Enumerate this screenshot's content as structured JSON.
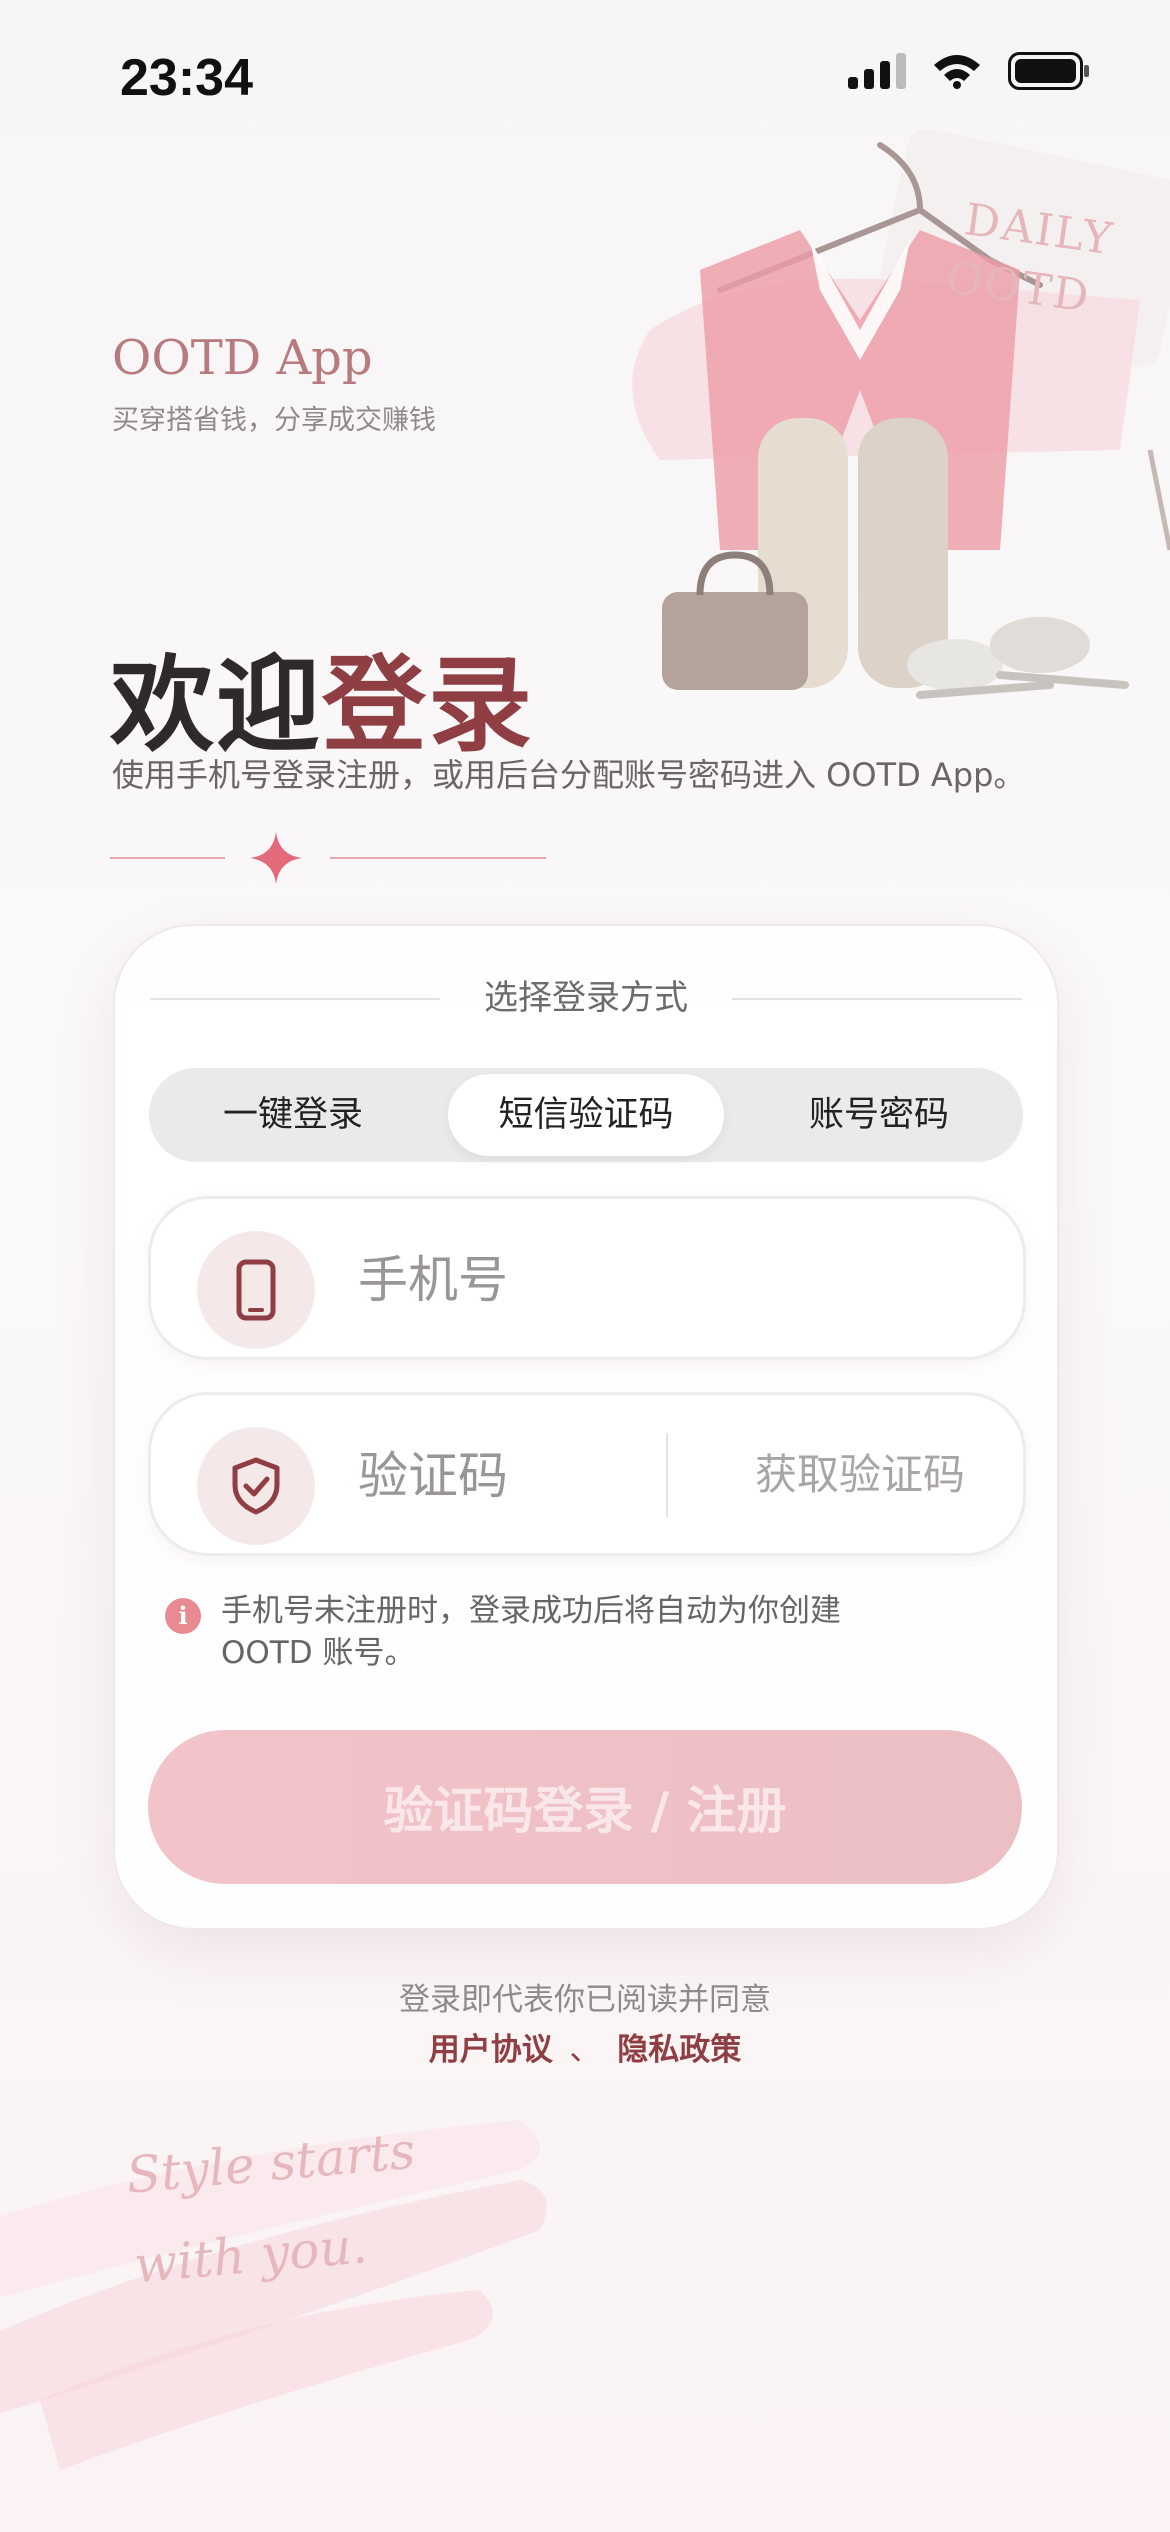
{
  "status_bar": {
    "time": "23:34"
  },
  "brand": {
    "name": "OOTD App",
    "slogan": "买穿搭省钱，分享成交赚钱"
  },
  "hero": {
    "tag_line1": "DAILY",
    "tag_line2": "OOTD"
  },
  "welcome": {
    "part1": "欢迎",
    "part2": "登录"
  },
  "subtitle": "使用手机号登录注册，或用后台分配账号密码进入 OOTD App。",
  "card": {
    "heading": "选择登录方式",
    "tabs": [
      {
        "label": "一键登录"
      },
      {
        "label": "短信验证码",
        "active": true
      },
      {
        "label": "账号密码"
      }
    ],
    "phone_placeholder": "手机号",
    "code_placeholder": "验证码",
    "get_code": "获取验证码",
    "notice": "手机号未注册时，登录成功后将自动为你创建 OOTD 账号。",
    "submit": "验证码登录 / 注册"
  },
  "agreement": {
    "text": "登录即代表你已阅读并同意",
    "terms": "用户协议",
    "separator": "、",
    "privacy": "隐私政策"
  },
  "decor": {
    "script_line1": "Style starts",
    "script_line2": "with you."
  },
  "colors": {
    "brand": "#8f3e43",
    "accent_pink": "#e88a92",
    "button_bg": "#f2c3c9"
  },
  "icons": [
    "cellular-signal-icon",
    "wifi-icon",
    "battery-icon",
    "sparkle-icon",
    "phone-icon",
    "shield-check-icon",
    "info-icon"
  ]
}
